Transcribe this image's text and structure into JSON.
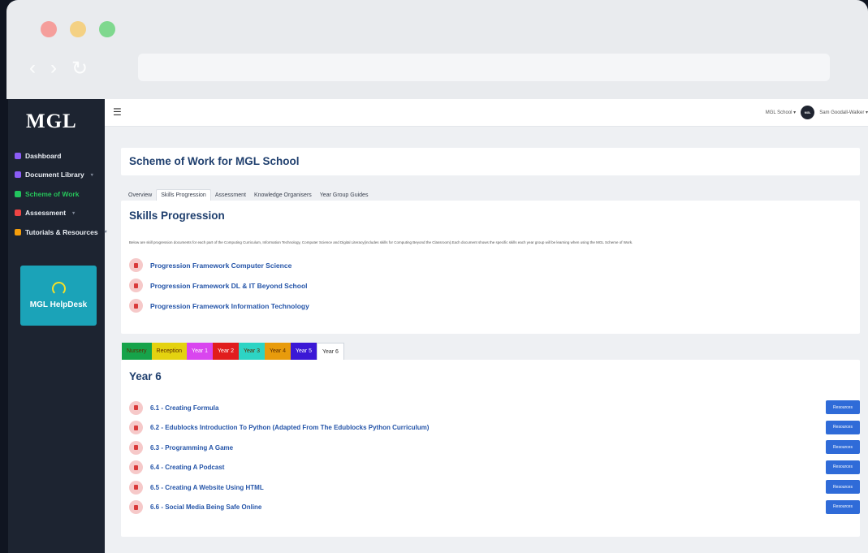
{
  "sidebar": {
    "logo": "MGL",
    "items": [
      {
        "label": "Dashboard",
        "icon": "dashboard-icon",
        "color": "#8b5cf6",
        "caret": ""
      },
      {
        "label": "Document Library",
        "icon": "document-library-icon",
        "color": "#8b5cf6",
        "caret": "▾"
      },
      {
        "label": "Scheme of Work",
        "icon": "scheme-icon",
        "color": "#22c55e",
        "caret": ""
      },
      {
        "label": "Assessment",
        "icon": "assessment-icon",
        "color": "#ef4444",
        "caret": "▾"
      },
      {
        "label": "Tutorials & Resources",
        "icon": "tutorials-icon",
        "color": "#f59e0b",
        "caret": "▾"
      }
    ],
    "helpdesk": "MGL HelpDesk"
  },
  "topbar": {
    "school": "MGL School ▾",
    "avatar": "MGL",
    "user": "Sam Goodall-Walker ▾"
  },
  "page": {
    "title": "Scheme of Work for MGL School",
    "tabs": [
      "Overview",
      "Skills Progression",
      "Assessment",
      "Knowledge Organisers",
      "Year Group Guides"
    ],
    "active_tab": "Skills Progression"
  },
  "skills": {
    "heading": "Skills Progression",
    "description": "Below are skill progression documents for each part of the Computing Curriculum, Information Technology, Computer Science and Digital Literacy(includes skills for Computing Beyond the Classroom).Each document shows the specific skills each year group will be learning when using the MGL Scheme of Work.",
    "documents": [
      "Progression Framework Computer Science",
      "Progression Framework DL & IT Beyond School",
      "Progression Framework Information Technology"
    ]
  },
  "year_tabs": [
    {
      "label": "Nursery",
      "color": "#16a34a"
    },
    {
      "label": "Reception",
      "color": "#e4d210"
    },
    {
      "label": "Year 1",
      "color": "#d946ef"
    },
    {
      "label": "Year 2",
      "color": "#e11d1d"
    },
    {
      "label": "Year 3",
      "color": "#2dd4c4"
    },
    {
      "label": "Year 4",
      "color": "#e89b0c"
    },
    {
      "label": "Year 5",
      "color": "#3b18d6"
    },
    {
      "label": "Year 6",
      "color": "#ffffff"
    }
  ],
  "year": {
    "heading": "Year 6",
    "button_label": "Resources",
    "units": [
      "6.1 - Creating Formula",
      "6.2 - Edublocks Introduction To Python (Adapted From The Edublocks Python Curriculum)",
      "6.3 - Programming A Game",
      "6.4 - Creating A Podcast",
      "6.5 - Creating A Website Using HTML",
      "6.6 - Social Media Being Safe Online"
    ]
  }
}
